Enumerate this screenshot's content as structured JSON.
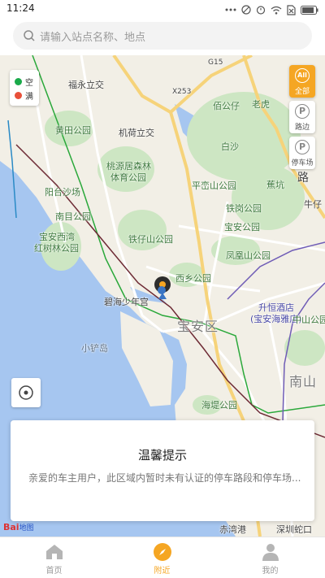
{
  "status_bar": {
    "time": "11:24"
  },
  "search": {
    "placeholder": "请输入站点名称、地点"
  },
  "legend": {
    "items": [
      {
        "label": "空",
        "color": "#1aaa4a"
      },
      {
        "label": "满",
        "color": "#e8503a"
      }
    ]
  },
  "filters": [
    {
      "icon_text": "All",
      "label": "全部",
      "active": true
    },
    {
      "icon_text": "P",
      "label": "路边",
      "active": false
    },
    {
      "icon_text": "P",
      "label": "停车场",
      "active": false
    }
  ],
  "map": {
    "labels": {
      "fuyong_lijiao": "福永立交",
      "huangtian_park": "黄田公园",
      "jichang_lijiao": "机荷立交",
      "taoyuanju": "桃源居森林",
      "tiyu_park": "体育公园",
      "yangtai_beach": "阳台沙场",
      "nanmu_park": "南目公园",
      "baoan_xiwan": "宝安西湾",
      "hongshulin": "红树林公园",
      "tiezaishan": "铁仔山公园",
      "xixiang_park": "西乡公园",
      "bihai_palace": "碧海少年宫",
      "xiaochan_island": "小铲岛",
      "baoan_district": "宝安区",
      "shengheng_hotel": "升恒酒店",
      "baoan_haiya": "(宝安海雅店)",
      "zhongshan_park": "中山公园",
      "nanshan": "南山",
      "haijing_park": "海堤公园",
      "chiwan_port": "赤湾港",
      "shekou_port": "深圳蛇口",
      "baigongzai": "佰公仔",
      "laohu": "老虎",
      "baisha": "白沙",
      "pingluo_park": "平峦山公园",
      "jiaokeng": "蕉坑",
      "tiegang_park": "铁岗公园",
      "baoan_park": "宝安公园",
      "fengshan_park": "凤凰山公园",
      "road_g15": "G15",
      "road_x253": "X253",
      "road_lu": "路",
      "niuzai": "牛仔"
    }
  },
  "notice": {
    "title": "温馨提示",
    "body": "亲爱的车主用户，此区域内暂时未有认证的停车路段和停车场..."
  },
  "logo": {
    "text": "Bai",
    "suffix": "地图"
  },
  "tabs": [
    {
      "label": "首页",
      "active": false
    },
    {
      "label": "附近",
      "active": true
    },
    {
      "label": "我的",
      "active": false
    }
  ],
  "colors": {
    "accent": "#f5a623",
    "water": "#a6c6f0",
    "park": "#cde6c3"
  }
}
